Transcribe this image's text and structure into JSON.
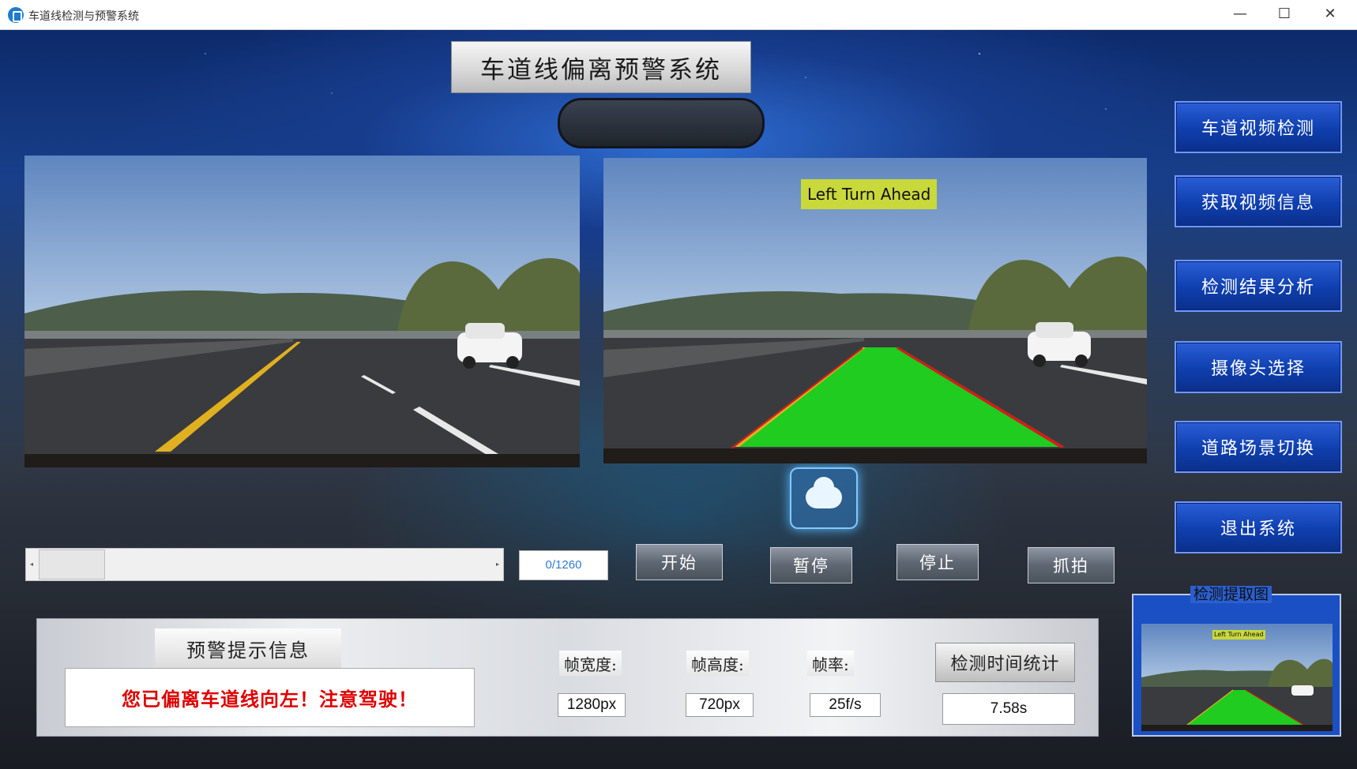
{
  "window": {
    "title": "车道线检测与预警系统",
    "minimize": "—",
    "maximize": "☐",
    "close": "✕"
  },
  "banner": {
    "title": "车道线偏离预警系统"
  },
  "video": {
    "overlay_label": "Left Turn Ahead"
  },
  "nav": {
    "items": [
      {
        "label": "车道视频检测"
      },
      {
        "label": "获取视频信息"
      },
      {
        "label": "检测结果分析"
      },
      {
        "label": "摄像头选择"
      },
      {
        "label": "道路场景切换"
      },
      {
        "label": "退出系统"
      }
    ]
  },
  "slider": {
    "left_arrow": "◂",
    "right_arrow": "▸",
    "position_fraction": 0,
    "counter": "0/1260"
  },
  "controls": {
    "start": "开始",
    "pause": "暂停",
    "stop": "停止",
    "capture": "抓拍"
  },
  "warning": {
    "header": "预警提示信息",
    "message": "您已偏离车道线向左！注意驾驶！"
  },
  "stats": {
    "width_label": "帧宽度:",
    "width_value": "1280px",
    "height_label": "帧高度:",
    "height_value": "720px",
    "fps_label": "帧率:",
    "fps_value": "25f/s",
    "time_button": "检测时间统计",
    "time_value": "7.58s"
  },
  "capture": {
    "legend": "检测提取图",
    "overlay_label": "Left Turn Ahead"
  },
  "colors": {
    "nav_blue": "#0f3fae",
    "lane_green": "#1fcc1f",
    "lane_edge_red": "#d81a1a",
    "warning_red": "#e00000",
    "label_yellow": "#c9d83a"
  }
}
